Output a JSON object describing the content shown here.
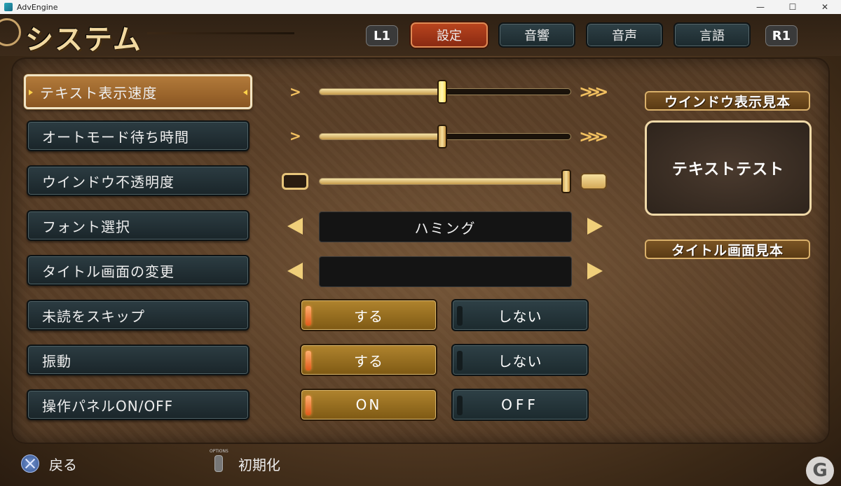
{
  "window": {
    "title": "AdvEngine",
    "minimize": "—",
    "maximize": "☐",
    "close": "✕"
  },
  "header": {
    "title": "システム",
    "tabs": [
      "設定",
      "音響",
      "音声",
      "言語"
    ],
    "active_tab": "設定",
    "left_shoulder": "L1",
    "right_shoulder": "R1"
  },
  "settings": {
    "text_speed": {
      "label": "テキスト表示速度",
      "value": 0.49
    },
    "auto_wait": {
      "label": "オートモード待ち時間",
      "value": 0.49
    },
    "window_opacity": {
      "label": "ウインドウ不透明度",
      "value": 0.98
    },
    "font": {
      "label": "フォント選択",
      "value": "ハミング"
    },
    "title_screen": {
      "label": "タイトル画面の変更",
      "value": ""
    },
    "skip_unread": {
      "label": "未読をスキップ",
      "on": "する",
      "off": "しない",
      "selected": "on"
    },
    "vibration": {
      "label": "振動",
      "on": "する",
      "off": "しない",
      "selected": "on"
    },
    "control_panel": {
      "label": "操作パネルON/OFF",
      "on": "ON",
      "off": "OFF",
      "selected": "on"
    }
  },
  "preview": {
    "window_sample_heading": "ウインドウ表示見本",
    "window_sample_text": "テキストテスト",
    "title_sample_heading": "タイトル画面見本"
  },
  "footer": {
    "back": "戻る",
    "options_small": "OPTIONS",
    "reset": "初期化"
  },
  "watermark": "G",
  "colors": {
    "accent": "#f2c060",
    "active_tab": "#b8441e",
    "panel": "#5c4129"
  }
}
